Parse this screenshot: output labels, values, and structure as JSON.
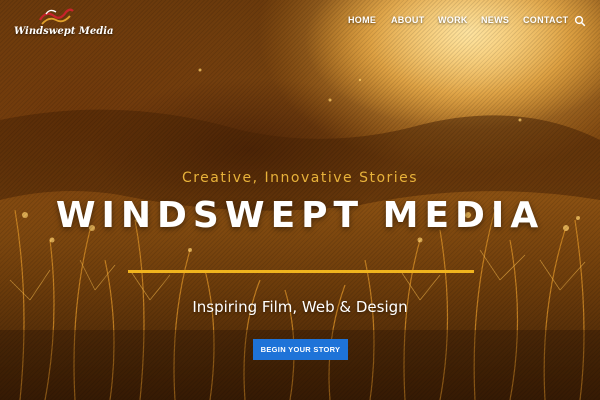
{
  "site": {
    "logo_text": "Windswept Media",
    "logo_icon": "wave-logo-icon"
  },
  "nav": {
    "items": [
      {
        "label": "HOME"
      },
      {
        "label": "ABOUT"
      },
      {
        "label": "WORK"
      },
      {
        "label": "NEWS"
      },
      {
        "label": "CONTACT"
      }
    ],
    "search_icon": "search-icon"
  },
  "hero": {
    "tagline": "Creative, Innovative Stories",
    "headline": "WINDSWEPT MEDIA",
    "subhead": "Inspiring Film, Web & Design",
    "cta_label": "BEGIN YOUR STORY"
  },
  "colors": {
    "accent": "#f0b41e",
    "button": "#1e73d8",
    "tagline": "#e8b23a"
  }
}
